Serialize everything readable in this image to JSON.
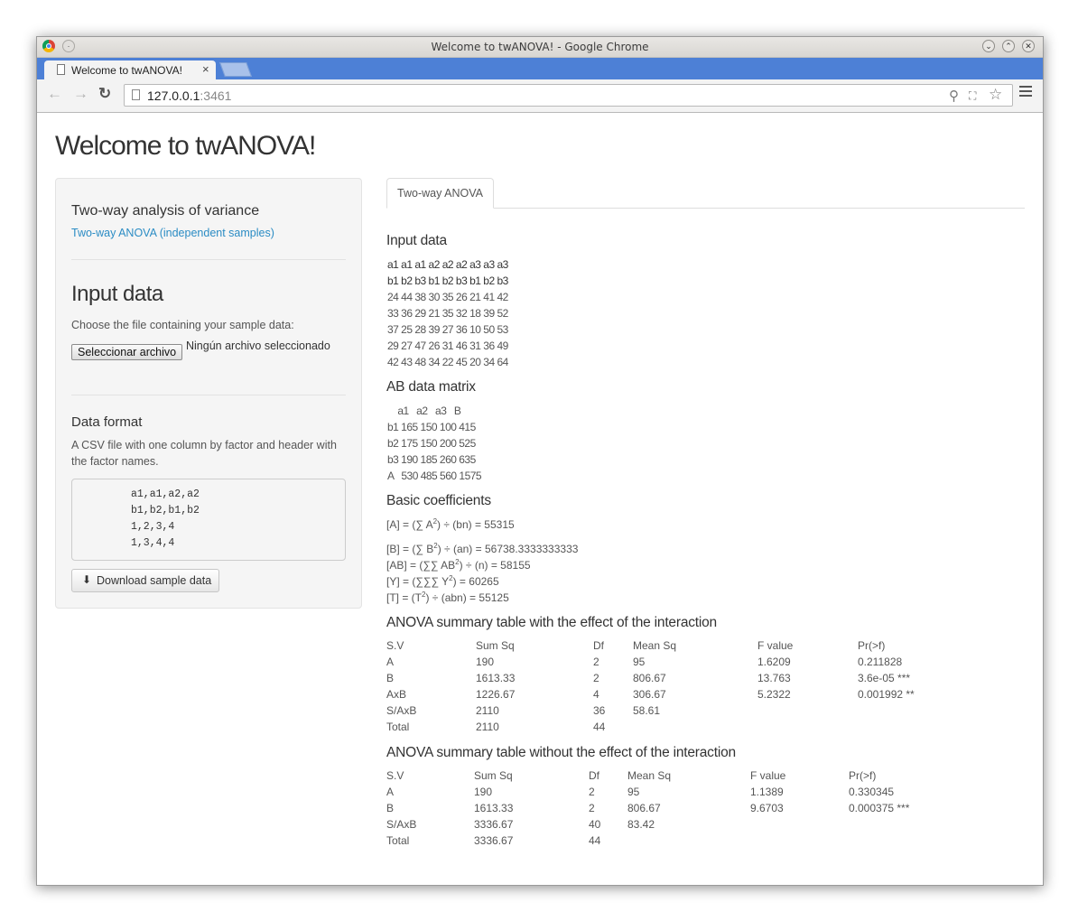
{
  "window": {
    "title": "Welcome to twANOVA! - Google Chrome"
  },
  "browser": {
    "tab_title": "Welcome to twANOVA!",
    "tab_close": "×",
    "url_host": "127.0.0.1",
    "url_port": ":3461"
  },
  "page": {
    "title": "Welcome to twANOVA!"
  },
  "sidebar": {
    "section1_title": "Two-way analysis of variance",
    "section1_link": "Two-way ANOVA (independent samples)",
    "input_title": "Input data",
    "input_prompt": "Choose the file containing your sample data:",
    "file_button": "Seleccionar archivo",
    "file_status": "Ningún archivo seleccionado",
    "format_title": "Data format",
    "format_desc_line1": "A CSV file with one column by factor and header with",
    "format_desc_line2": "the factor names.",
    "code_lines": [
      "a1,a1,a2,a2",
      "b1,b2,b1,b2",
      "1,2,3,4",
      "1,3,4,4"
    ],
    "download_button": "Download sample data"
  },
  "main": {
    "tab_label": "Two-way ANOVA",
    "input_data_title": "Input data",
    "input_data_rows": [
      "a1 a1 a1 a2 a2 a2 a3 a3 a3",
      "b1 b2 b3 b1 b2 b3 b1 b2 b3",
      "24 44 38 30 35 26 21 41 42",
      "33 36 29 21 35 32 18 39 52",
      "37 25 28 39 27 36 10 50 53",
      "29 27 47 26 31 46 31 36 49",
      "42 43 48 34 22 45 20 34 64"
    ],
    "ab_title": "AB data matrix",
    "ab_rows": [
      "    a1   a2   a3   B",
      "b1 165 150 100 415",
      "b2 175 150 200 525",
      "b3 190 185 260 635",
      "A   530 485 560 1575"
    ],
    "coef_title": "Basic coefficients",
    "coef_A_left": "[A] = (∑ A",
    "coef_A_right": ") ÷ (bn) = 55315",
    "coef_B_left": "[B] = (∑ B",
    "coef_B_right": ") ÷ (an) = 56738.3333333333",
    "coef_AB_left": "[AB] = (∑∑ AB",
    "coef_AB_right": ") ÷ (n) = 58155",
    "coef_Y_left": "[Y] = (∑∑∑ Y",
    "coef_Y_right": ") = 60265",
    "coef_T_left": "[T] = (T",
    "coef_T_right": ") ÷ (abn) = 55125",
    "sup2": "2",
    "anova1_title": "ANOVA summary table with the effect of the interaction",
    "anova1": {
      "headers": [
        "S.V",
        "Sum Sq",
        "Df",
        "Mean Sq",
        "F value",
        "Pr(>f)"
      ],
      "rows": [
        [
          "A",
          "190",
          "2",
          "95",
          "1.6209",
          "0.211828"
        ],
        [
          "B",
          "1613.33",
          "2",
          "806.67",
          "13.763",
          "3.6e-05 ***"
        ],
        [
          "AxB",
          "1226.67",
          "4",
          "306.67",
          "5.2322",
          "0.001992 **"
        ],
        [
          "S/AxB",
          "2110",
          "36",
          "58.61",
          "",
          ""
        ],
        [
          "Total",
          "2110",
          "44",
          "",
          "",
          ""
        ]
      ]
    },
    "anova2_title": "ANOVA summary table without the effect of the interaction",
    "anova2": {
      "headers": [
        "S.V",
        "Sum Sq",
        "Df",
        "Mean Sq",
        "F value",
        "Pr(>f)"
      ],
      "rows": [
        [
          "A",
          "190",
          "2",
          "95",
          "1.1389",
          "0.330345"
        ],
        [
          "B",
          "1613.33",
          "2",
          "806.67",
          "9.6703",
          "0.000375 ***"
        ],
        [
          "S/AxB",
          "3336.67",
          "40",
          "83.42",
          "",
          ""
        ],
        [
          "Total",
          "3336.67",
          "44",
          "",
          "",
          ""
        ]
      ]
    }
  }
}
